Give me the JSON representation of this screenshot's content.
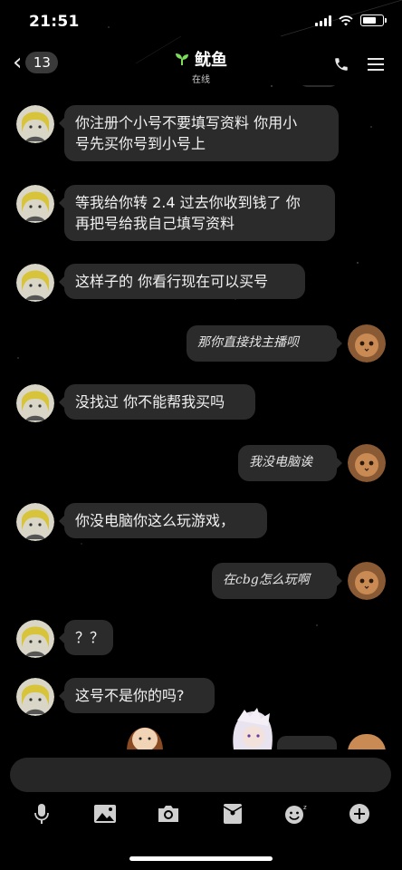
{
  "status_bar": {
    "time": "21:51",
    "battery_level": 0.75
  },
  "header": {
    "back_count": "13",
    "contact_name": "鱿鱼",
    "status": "在线"
  },
  "messages": [
    {
      "side": "left",
      "lines": [
        "你注册个小号不要填写资料 你用小",
        "号先买你号到小号上"
      ]
    },
    {
      "side": "left",
      "lines": [
        "等我给你转 2.4 过去你收到钱了 你",
        "再把号给我自己填写资料"
      ]
    },
    {
      "side": "left",
      "lines": [
        "这样子的 你看行现在可以买号"
      ]
    },
    {
      "side": "right",
      "lines": [
        "那你直接找主播呗"
      ]
    },
    {
      "side": "left",
      "lines": [
        "没找过 你不能帮我买吗"
      ]
    },
    {
      "side": "right",
      "lines": [
        "我没电脑诶"
      ]
    },
    {
      "side": "left",
      "lines": [
        "你没电脑你这么玩游戏，"
      ]
    },
    {
      "side": "right",
      "lines": [
        "在cbg怎么玩啊"
      ]
    },
    {
      "side": "left",
      "lines": [
        "？？"
      ]
    },
    {
      "side": "left",
      "lines": [
        "这号不是你的吗?"
      ]
    }
  ],
  "toolbar": [
    "microphone-icon",
    "image-icon",
    "camera-icon",
    "red-packet-icon",
    "emoji-icon",
    "plus-icon"
  ],
  "colors": {
    "background": "#000000",
    "bubble": "#2b2b2b",
    "sprout": "#7ddc5a"
  }
}
